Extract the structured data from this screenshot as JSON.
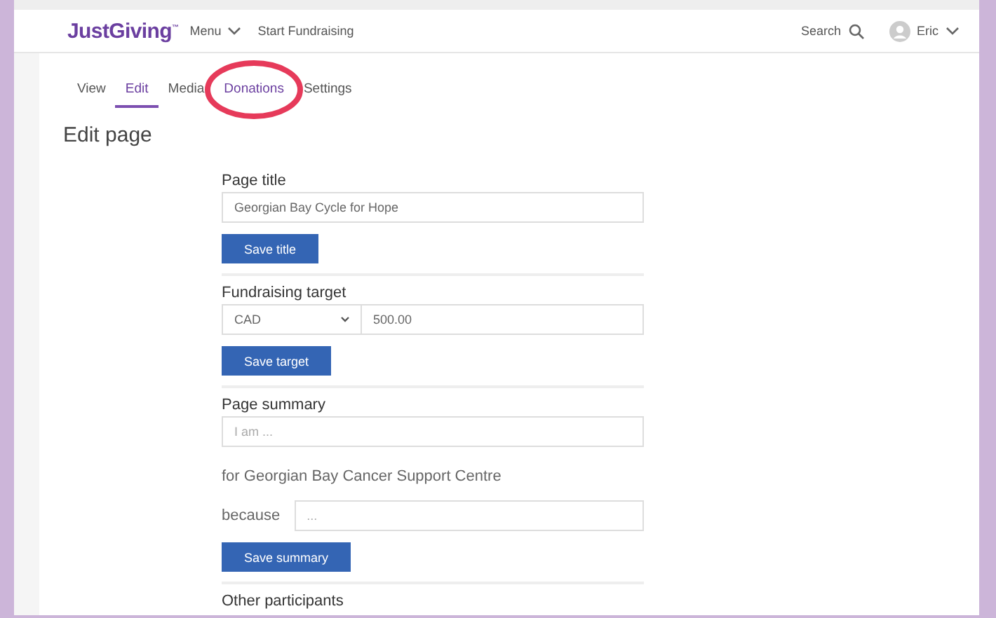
{
  "header": {
    "logo": "JustGiving",
    "logo_mark": "™",
    "menu": "Menu",
    "start": "Start Fundraising",
    "search": "Search",
    "user": "Eric"
  },
  "tabs": [
    {
      "label": "View",
      "selected": false,
      "circled": false
    },
    {
      "label": "Edit",
      "selected": true,
      "circled": false
    },
    {
      "label": "Media",
      "selected": false,
      "circled": false
    },
    {
      "label": "Donations",
      "selected": false,
      "circled": true
    },
    {
      "label": "Settings",
      "selected": false,
      "circled": false
    }
  ],
  "heading": "Edit page",
  "sections": [
    {
      "kind": "title",
      "label": "Page title",
      "value": "Georgian Bay Cycle for Hope",
      "button": "Save title"
    },
    {
      "kind": "target",
      "label": "Fundraising target",
      "currency": "CAD",
      "value": "500.00",
      "button": "Save target"
    },
    {
      "kind": "summary",
      "label": "Page summary",
      "placeholder": "I am ...",
      "charity": "for Georgian Bay Cancer Support Centre",
      "because": "because",
      "because_placeholder": "...",
      "button": "Save summary"
    },
    {
      "kind": "heading",
      "label": "Other participants"
    }
  ]
}
